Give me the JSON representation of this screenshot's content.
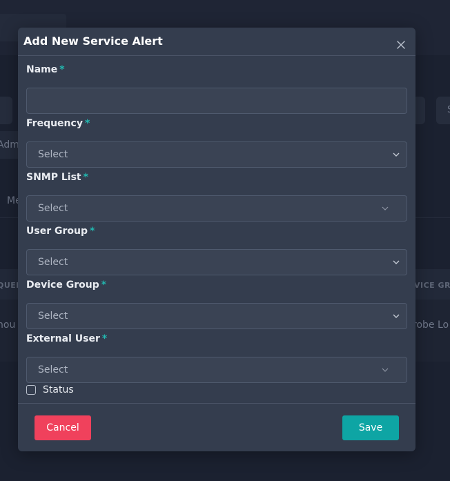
{
  "background": {
    "admin_fragment": "Adm",
    "tab_fragment": "Me",
    "right_pill_fragment": "S",
    "col1_fragment": "QUEN",
    "col2_fragment": "VICE GRO",
    "row_cell1_fragment": "hou",
    "row_cell2_fragment": "robe Lo"
  },
  "modal": {
    "title": "Add New Service Alert",
    "close_icon": "close-icon",
    "required_marker": "*",
    "fields": {
      "name": {
        "label": "Name",
        "value": "",
        "placeholder": ""
      },
      "frequency": {
        "label": "Frequency",
        "value": "Select"
      },
      "snmp_list": {
        "label": "SNMP List",
        "value": "Select"
      },
      "user_group": {
        "label": "User Group",
        "value": "Select"
      },
      "device_group": {
        "label": "Device Group",
        "value": "Select"
      },
      "external_user": {
        "label": "External User",
        "value": "Select"
      }
    },
    "status": {
      "label": "Status",
      "checked": false
    },
    "cancel_label": "Cancel",
    "save_label": "Save"
  },
  "colors": {
    "accent": "#22b8b0",
    "cancel": "#f0415c",
    "save": "#0ea5a4",
    "modal_bg": "#343d4e",
    "page_bg": "#1b2130"
  }
}
